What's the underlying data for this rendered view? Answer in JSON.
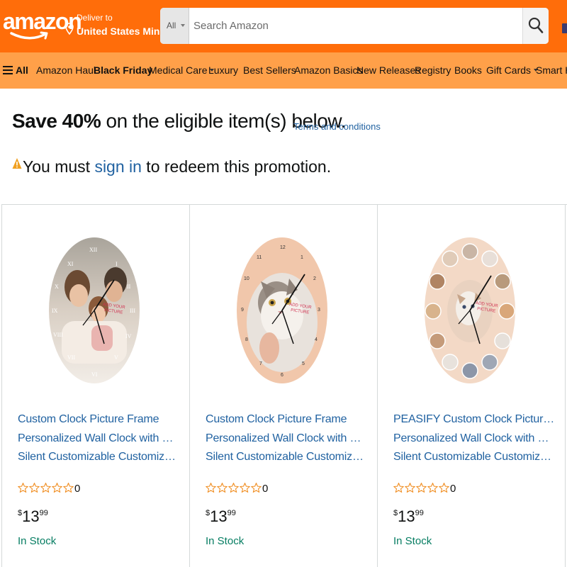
{
  "header": {
    "logo_text": "amazon",
    "deliver_line1": "Deliver to",
    "deliver_line2": "United States Min...",
    "search_scope": "All",
    "search_placeholder": "Search Amazon"
  },
  "nav": {
    "all_label": "All",
    "items": [
      "Amazon Haul",
      "Black Friday",
      "Medical Care",
      "Luxury",
      "Best Sellers",
      "Amazon Basics",
      "New Releases",
      "Registry",
      "Books",
      "Gift Cards",
      "Smart Ho"
    ]
  },
  "promo": {
    "save_bold": "Save 40%",
    "save_rest": " on the eligible item(s) below.",
    "terms_link": "Terms and conditions",
    "must_prefix": "You must ",
    "sign_in_link": "sign in",
    "must_suffix": " to redeem this promotion."
  },
  "products": [
    {
      "title_lines": [
        "Custom Clock Picture Frame",
        "Personalized Wall Clock with Photo",
        "Silent Customizable Customized Wall..."
      ],
      "rating_count": "0",
      "price_symbol": "$",
      "price_whole": "13",
      "price_fraction": "99",
      "stock": "In Stock",
      "image_overlay_text": "ADD YOUR PICTURE"
    },
    {
      "title_lines": [
        "Custom Clock Picture Frame",
        "Personalized Wall Clock with Photo",
        "Silent Customizable Customized Wall..."
      ],
      "rating_count": "0",
      "price_symbol": "$",
      "price_whole": "13",
      "price_fraction": "99",
      "stock": "In Stock",
      "image_overlay_text": "ADD YOUR PICTURE"
    },
    {
      "title_lines": [
        "PEASIFY Custom Clock Picture Frame",
        "Personalized Wall Clock with Photo",
        "Silent Customizable Customized Wall..."
      ],
      "rating_count": "0",
      "price_symbol": "$",
      "price_whole": "13",
      "price_fraction": "99",
      "stock": "In Stock",
      "image_overlay_text": "ADD YOUR PICTURE"
    }
  ],
  "colors": {
    "header_bg": "#ff6d0a",
    "nav_bg": "#ffa049",
    "link": "#2162a1",
    "stock": "#067d62",
    "star": "#f08c1e"
  }
}
